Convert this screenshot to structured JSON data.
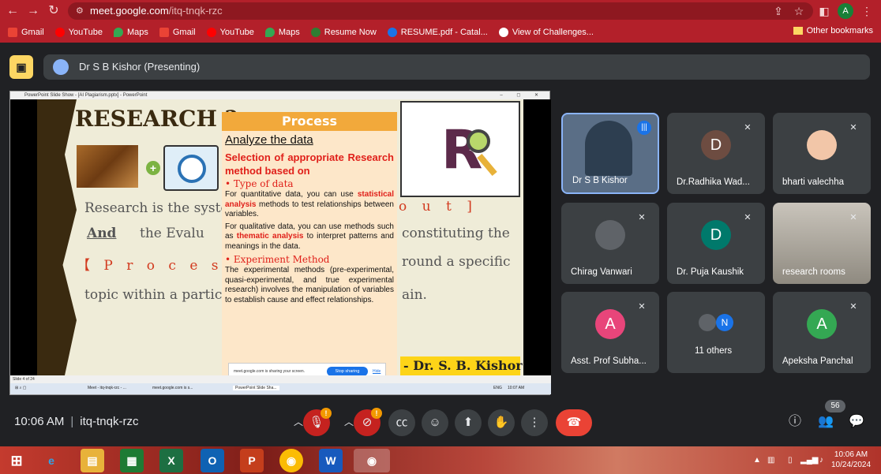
{
  "browser": {
    "url_host": "meet.google.com",
    "url_path": "/itq-tnqk-rzc",
    "profile_initial": "A",
    "bookmarks": [
      {
        "label": "Gmail",
        "icon": "gmail-icon",
        "color": "#ea4335"
      },
      {
        "label": "YouTube",
        "icon": "youtube-icon",
        "color": "#ff0000"
      },
      {
        "label": "Maps",
        "icon": "maps-icon",
        "color": "#34a853"
      },
      {
        "label": "Gmail",
        "icon": "gmail-icon",
        "color": "#ea4335"
      },
      {
        "label": "YouTube",
        "icon": "youtube-icon",
        "color": "#ff0000"
      },
      {
        "label": "Maps",
        "icon": "maps-icon",
        "color": "#34a853"
      },
      {
        "label": "Resume Now",
        "icon": "resume-icon",
        "color": "#2e7d32"
      },
      {
        "label": "RESUME.pdf - Catal...",
        "icon": "pdf-icon",
        "color": "#1a73e8"
      },
      {
        "label": "View of Challenges...",
        "icon": "globe-icon",
        "color": "#ffffff"
      }
    ],
    "other_bookmarks": "Other bookmarks"
  },
  "meet": {
    "presenter_label": "Dr S B Kishor (Presenting)",
    "slide_window": {
      "title": "PowerPoint Slide Show - [AI Plagiarism.pptx] - PowerPoint",
      "status": "Slide 4 of 24",
      "taskbar_items": [
        "Meet - itq-tnqk-rzc - ...",
        "meet.google.com is s...",
        "PowerPoint Slide Sha..."
      ],
      "taskbar_time": "10:07 AM",
      "taskbar_lang": "ENG"
    },
    "slide": {
      "heading": "RESEARCH ?",
      "bg_line1": "Research is the syste",
      "bg_line1_red": "o u t ]",
      "bg_line2_a": "And",
      "bg_line2_b": "the    Evalu",
      "bg_line2_c": "constituting    the",
      "bg_line3_red": "【 P r o c e s s 】",
      "bg_line3_c": "round a specific",
      "bg_line4": "topic within a particu",
      "bg_line4_c": "ain.",
      "process_title": "Process",
      "analyze": "Analyze the data",
      "selection": "Selection of appropriate Research method based on",
      "bullet1": "•  Type of data",
      "quant_a": "For quantitative data, you can use ",
      "quant_hl": "statistical analysis",
      "quant_b": " methods to test relationships between variables.",
      "qual_a": "For qualitative data, you can use methods such as ",
      "qual_hl": "thematic analysis",
      "qual_b": " to interpret patterns and meanings in the data.",
      "bullet2": "•  Experiment Method",
      "experiment": "The experimental methods (pre-experimental, quasi-experimental, and true experimental research) involves the manipulation of variables to establish cause and effect relationships.",
      "author": "- Dr. S. B. Kishor",
      "share_msg": "meet.google.com is sharing your screen.",
      "stop_sharing": "Stop sharing",
      "hide": "Hide"
    },
    "participants": [
      {
        "name": "Dr S B Kishor",
        "initial": "",
        "color": "#4a6b8a",
        "speaking": true
      },
      {
        "name": "Dr.Radhika Wad...",
        "initial": "D",
        "color": "#6d4c41"
      },
      {
        "name": "bharti valechha",
        "initial": "",
        "color": "#f2c6a8"
      },
      {
        "name": "Chirag Vanwari",
        "initial": "",
        "color": "#5f6368"
      },
      {
        "name": "Dr. Puja Kaushik",
        "initial": "D",
        "color": "#00796b"
      },
      {
        "name": "research rooms",
        "initial": "",
        "color": "#8d8d8d"
      },
      {
        "name": "Asst. Prof Subha...",
        "initial": "A",
        "color": "#e8457a"
      },
      {
        "name": "11 others",
        "initial": "N",
        "color": "#1a73e8"
      },
      {
        "name": "Apeksha Panchal",
        "initial": "A",
        "color": "#34a853"
      }
    ],
    "time": "10:06 AM",
    "meeting_code": "itq-tnqk-rzc",
    "participant_count": "56"
  },
  "windows": {
    "clock_time": "10:06 AM",
    "clock_date": "10/24/2024"
  }
}
